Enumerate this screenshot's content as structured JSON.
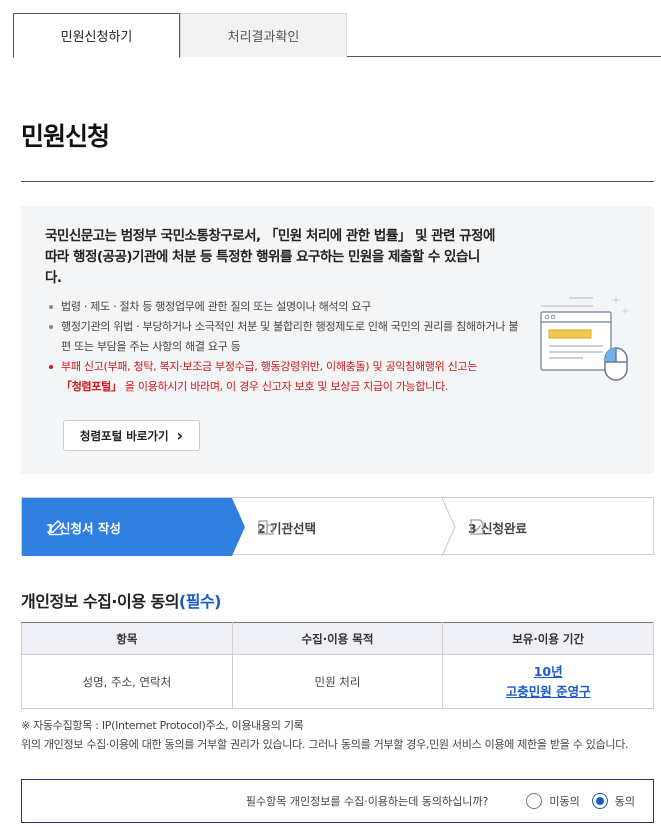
{
  "tabs": {
    "apply": "민원신청하기",
    "result": "처리결과확인"
  },
  "page_title": "민원신청",
  "info": {
    "lead": "국민신문고는 범정부 국민소통창구로서, 「민원 처리에 관한 법률」 및 관련 규정에 따라 행정(공공)기관에 처분 등 특정한 행위를 요구하는 민원을 제출할 수 있습니다.",
    "bullet1": "법령 · 제도 · 절차 등 행정업무에 관한 질의 또는 설명이나 해석의 요구",
    "bullet2": "행정기관의 위법 · 부당하거나 소극적인 처분 및 불합리한 행정제도로 인해 국민의 권리를 침해하거나 불편 또는 부담을 주는 사항의 해결 요구 등",
    "bullet3": "부패 신고(부패, 청탁, 복지·보조금 부정수급, 행동강령위반, 이해충돌) 및 공익침해행위 신고는",
    "bullet3_portal": "「청렴포털」",
    "bullet3_tail": " 을 이용하시기 바라며, 이 경우 신고자 보호 및 보상금 지급이 가능합니다.",
    "portal_button": "청렴포털 바로가기",
    "chevron": "›"
  },
  "steps": [
    {
      "label": "1 신청서 작성",
      "icon": "pencil-icon"
    },
    {
      "label": "2 기관선택",
      "icon": "building-icon"
    },
    {
      "label": "3 신청완료",
      "icon": "document-check-icon"
    }
  ],
  "consent": {
    "title": "개인정보 수집·이용 동의",
    "required": "(필수)",
    "headers": [
      "항목",
      "수집·이용 목적",
      "보유·이용 기간"
    ],
    "row": {
      "items": "성명, 주소, 연락처",
      "purpose": "민원 처리",
      "period_line1": "10년",
      "period_line2": "고충민원 준영구"
    },
    "note1": "※ 자동수집항목 : IP(Internet Protocol)주소, 이용내용의 기록",
    "note2": "위의 개인정보 수집·이용에 대한 동의를 거부할 권리가 있습니다. 그러나 동의를 거부할 경우,민원 서비스 이용에 제한을 받을 수 있습니다.",
    "question": "필수항목 개인정보를 수집·이용하는데 동의하십니까?",
    "disagree": "미동의",
    "agree": "동의",
    "selected": "동의"
  },
  "colors": {
    "accent": "#2f7fe0",
    "required_blue": "#1a5bc6",
    "warning_red": "#d0191b",
    "info_bg": "#f4f5f7"
  }
}
